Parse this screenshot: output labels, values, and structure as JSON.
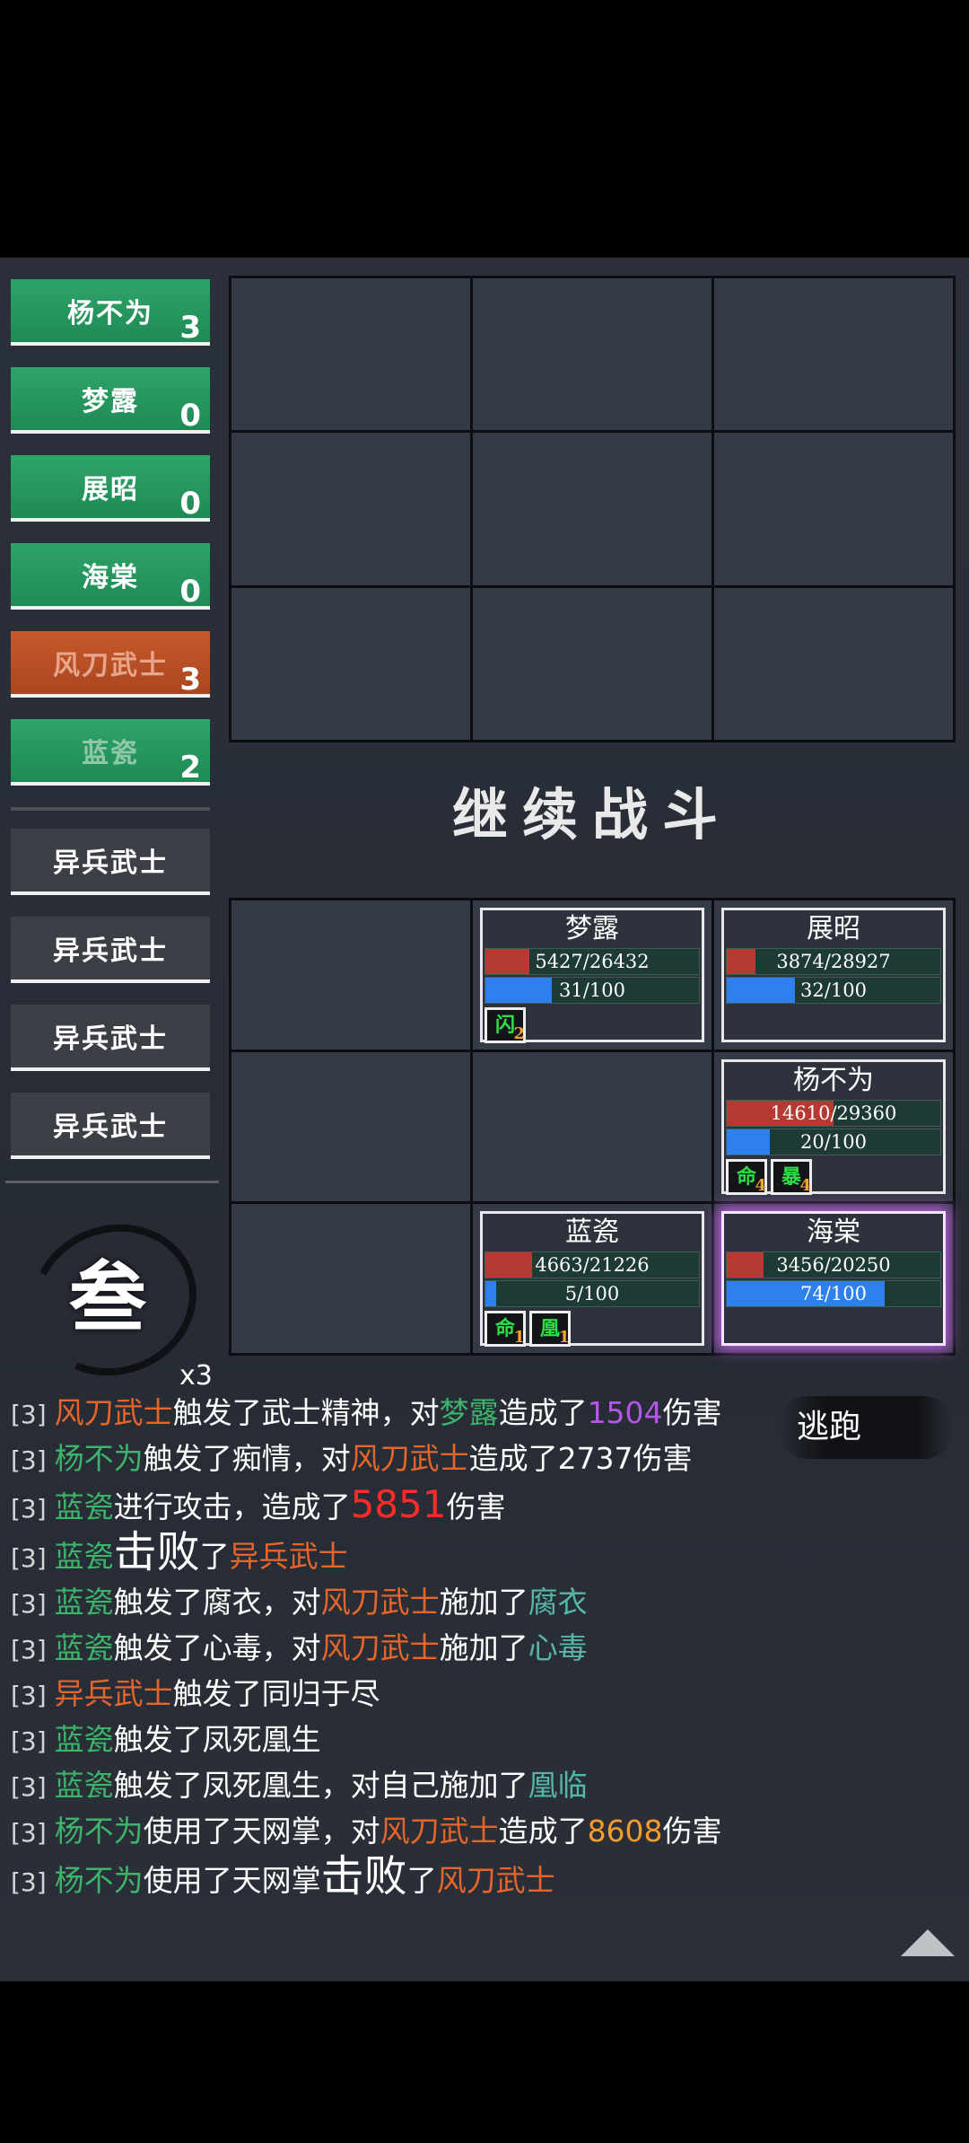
{
  "turn_order": [
    {
      "name": "杨不为",
      "count": "3",
      "type": "ally"
    },
    {
      "name": "梦露",
      "count": "0",
      "type": "ally"
    },
    {
      "name": "展昭",
      "count": "0",
      "type": "ally"
    },
    {
      "name": "海棠",
      "count": "0",
      "type": "ally"
    },
    {
      "name": "风刀武士",
      "count": "3",
      "type": "enemy-act"
    },
    {
      "name": "蓝瓷",
      "count": "2",
      "type": "ally-dim"
    },
    {
      "name": "异兵武士",
      "count": "",
      "type": "enemy"
    },
    {
      "name": "异兵武士",
      "count": "",
      "type": "enemy"
    },
    {
      "name": "异兵武士",
      "count": "",
      "type": "enemy"
    },
    {
      "name": "异兵武士",
      "count": "",
      "type": "enemy"
    }
  ],
  "round": {
    "glyph": "叁",
    "multiplier": "x3"
  },
  "continue_label": "继续战斗",
  "flee_label": "逃跑",
  "units": {
    "menglu": {
      "name": "梦露",
      "hp_text": "5427/26432",
      "hp_fraction": 0.205,
      "mp_text": "31/100",
      "mp_fraction": 0.31,
      "buffs": [
        {
          "glyph": "闪",
          "count": "2"
        }
      ]
    },
    "zhanzhao": {
      "name": "展昭",
      "hp_text": "3874/28927",
      "hp_fraction": 0.134,
      "mp_text": "32/100",
      "mp_fraction": 0.32,
      "buffs": []
    },
    "yangbuwei": {
      "name": "杨不为",
      "hp_text": "14610/29360",
      "hp_fraction": 0.498,
      "mp_text": "20/100",
      "mp_fraction": 0.2,
      "buffs": [
        {
          "glyph": "命",
          "count": "4"
        },
        {
          "glyph": "暴",
          "count": "4"
        }
      ]
    },
    "lanci": {
      "name": "蓝瓷",
      "hp_text": "4663/21226",
      "hp_fraction": 0.22,
      "mp_text": "5/100",
      "mp_fraction": 0.05,
      "buffs": [
        {
          "glyph": "命",
          "count": "1"
        },
        {
          "glyph": "凰",
          "count": "1"
        }
      ]
    },
    "haitang": {
      "name": "海棠",
      "hp_text": "3456/20250",
      "hp_fraction": 0.171,
      "mp_text": "74/100",
      "mp_fraction": 0.74,
      "buffs": []
    }
  },
  "log": [
    [
      {
        "t": "[3] ",
        "c": "turn"
      },
      {
        "t": "风刀武士",
        "c": "c-enemy"
      },
      {
        "t": "触发了武士精神，对"
      },
      {
        "t": "梦露",
        "c": "c-ally"
      },
      {
        "t": "造成了"
      },
      {
        "t": "1504",
        "c": "c-purple"
      },
      {
        "t": "伤害"
      }
    ],
    [
      {
        "t": "[3] ",
        "c": "turn"
      },
      {
        "t": "杨不为",
        "c": "c-ally"
      },
      {
        "t": "触发了痴情，对"
      },
      {
        "t": "风刀武士",
        "c": "c-enemy"
      },
      {
        "t": "造成了2737伤害"
      }
    ],
    [
      {
        "t": "[3] ",
        "c": "turn"
      },
      {
        "t": "蓝瓷",
        "c": "c-ally"
      },
      {
        "t": "进行攻击，造成了"
      },
      {
        "t": "5851",
        "c": "c-red"
      },
      {
        "t": "伤害"
      }
    ],
    [
      {
        "t": "[3] ",
        "c": "turn"
      },
      {
        "t": "蓝瓷",
        "c": "c-ally"
      },
      {
        "t": "击败",
        "c": "big"
      },
      {
        "t": "了"
      },
      {
        "t": "异兵武士",
        "c": "c-enemy"
      }
    ],
    [
      {
        "t": "[3] ",
        "c": "turn"
      },
      {
        "t": "蓝瓷",
        "c": "c-ally"
      },
      {
        "t": "触发了腐衣，对"
      },
      {
        "t": "风刀武士",
        "c": "c-enemy"
      },
      {
        "t": "施加了"
      },
      {
        "t": "腐衣",
        "c": "c-teal"
      }
    ],
    [
      {
        "t": "[3] ",
        "c": "turn"
      },
      {
        "t": "蓝瓷",
        "c": "c-ally"
      },
      {
        "t": "触发了心毒，对"
      },
      {
        "t": "风刀武士",
        "c": "c-enemy"
      },
      {
        "t": "施加了"
      },
      {
        "t": "心毒",
        "c": "c-teal"
      }
    ],
    [
      {
        "t": "[3] ",
        "c": "turn"
      },
      {
        "t": "异兵武士",
        "c": "c-enemy"
      },
      {
        "t": "触发了同归于尽"
      }
    ],
    [
      {
        "t": "[3] ",
        "c": "turn"
      },
      {
        "t": "蓝瓷",
        "c": "c-ally"
      },
      {
        "t": "触发了凤死凰生"
      }
    ],
    [
      {
        "t": "[3] ",
        "c": "turn"
      },
      {
        "t": "蓝瓷",
        "c": "c-ally"
      },
      {
        "t": "触发了凤死凰生，对自己施加了"
      },
      {
        "t": "凰临",
        "c": "c-teal"
      }
    ],
    [
      {
        "t": "[3] ",
        "c": "turn"
      },
      {
        "t": "杨不为",
        "c": "c-ally"
      },
      {
        "t": "使用了天网掌，对"
      },
      {
        "t": "风刀武士",
        "c": "c-enemy"
      },
      {
        "t": "造成了"
      },
      {
        "t": "8608",
        "c": "c-orange"
      },
      {
        "t": "伤害"
      }
    ],
    [
      {
        "t": "[3] ",
        "c": "turn"
      },
      {
        "t": "杨不为",
        "c": "c-ally"
      },
      {
        "t": "使用了天网掌"
      },
      {
        "t": "击败",
        "c": "big"
      },
      {
        "t": "了"
      },
      {
        "t": "风刀武士",
        "c": "c-enemy"
      }
    ]
  ]
}
